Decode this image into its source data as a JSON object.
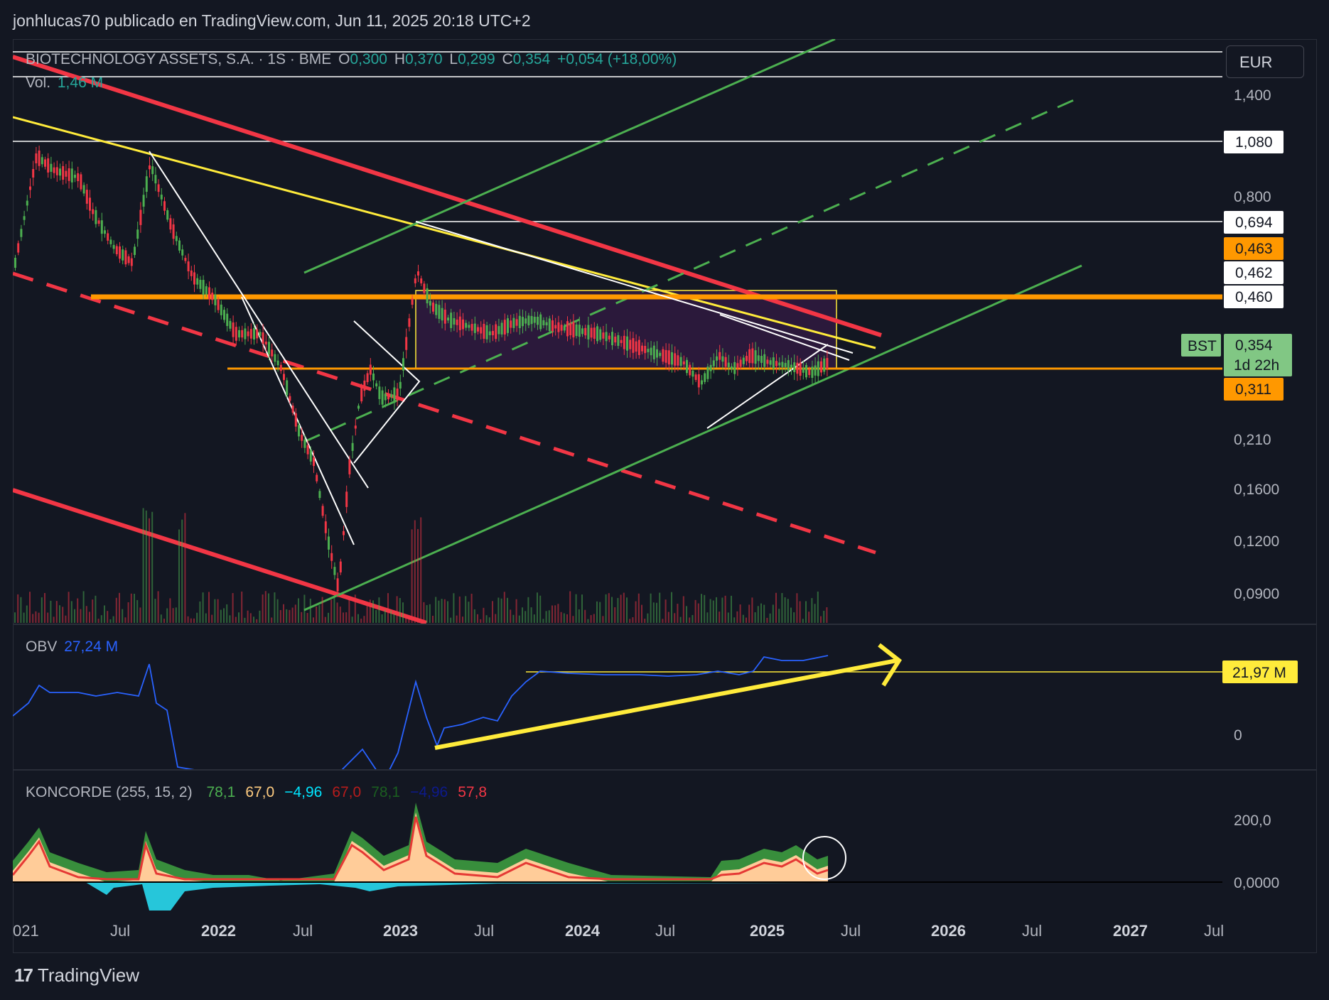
{
  "caption": "jonhlucas70 publicado en TradingView.com, Jun 11, 2025 20:18 UTC+2",
  "currency": "EUR",
  "legend": {
    "symbol": "BIOTECHNOLOGY ASSETS, S.A. · 1S · BME",
    "o_label": "O",
    "o_value": "0,300",
    "h_label": "H",
    "h_value": "0,370",
    "l_label": "L",
    "l_value": "0,299",
    "c_label": "C",
    "c_value": "0,354",
    "change": "+0,054 (+18,00%)",
    "vol_label": "Vol.",
    "vol_value": "1,46 M"
  },
  "price_axis": {
    "ticks": [
      "1,400",
      "1,080",
      "0,800",
      "0,694",
      "0,463",
      "0,462",
      "0,460",
      "0,354",
      "1d 22h",
      "0,311",
      "0,210",
      "0,1600",
      "0,1200",
      "0,0900"
    ],
    "symbol_badge": "BST"
  },
  "obv": {
    "label": "OBV",
    "value": "27,24 M",
    "axis_badge": "21,97 M",
    "axis_zero": "0"
  },
  "koncorde": {
    "label": "KONCORDE (255, 15, 2)",
    "values": [
      "78,1",
      "67,0",
      "−4,96",
      "67,0",
      "78,1",
      "−4,96",
      "57,8"
    ],
    "value_colors": [
      "#4caf50",
      "#ffcc80",
      "#00e5ff",
      "#b71c1c",
      "#1b5e20",
      "#0d1a8c",
      "#f23645"
    ],
    "axis": [
      "200,0",
      "0,0000"
    ]
  },
  "time_axis": [
    "021",
    "Jul",
    "2022",
    "Jul",
    "2023",
    "Jul",
    "2024",
    "Jul",
    "2025",
    "Jul",
    "2026",
    "Jul",
    "2027",
    "Jul"
  ],
  "footer": {
    "brand": "TradingView"
  },
  "colors": {
    "background": "#131722",
    "up": "#4caf50",
    "down": "#f23645",
    "orange": "#ff9800",
    "yellow": "#ffeb3b",
    "red": "#f23645",
    "green_channel": "#4caf50",
    "obv_line": "#2962ff"
  }
}
